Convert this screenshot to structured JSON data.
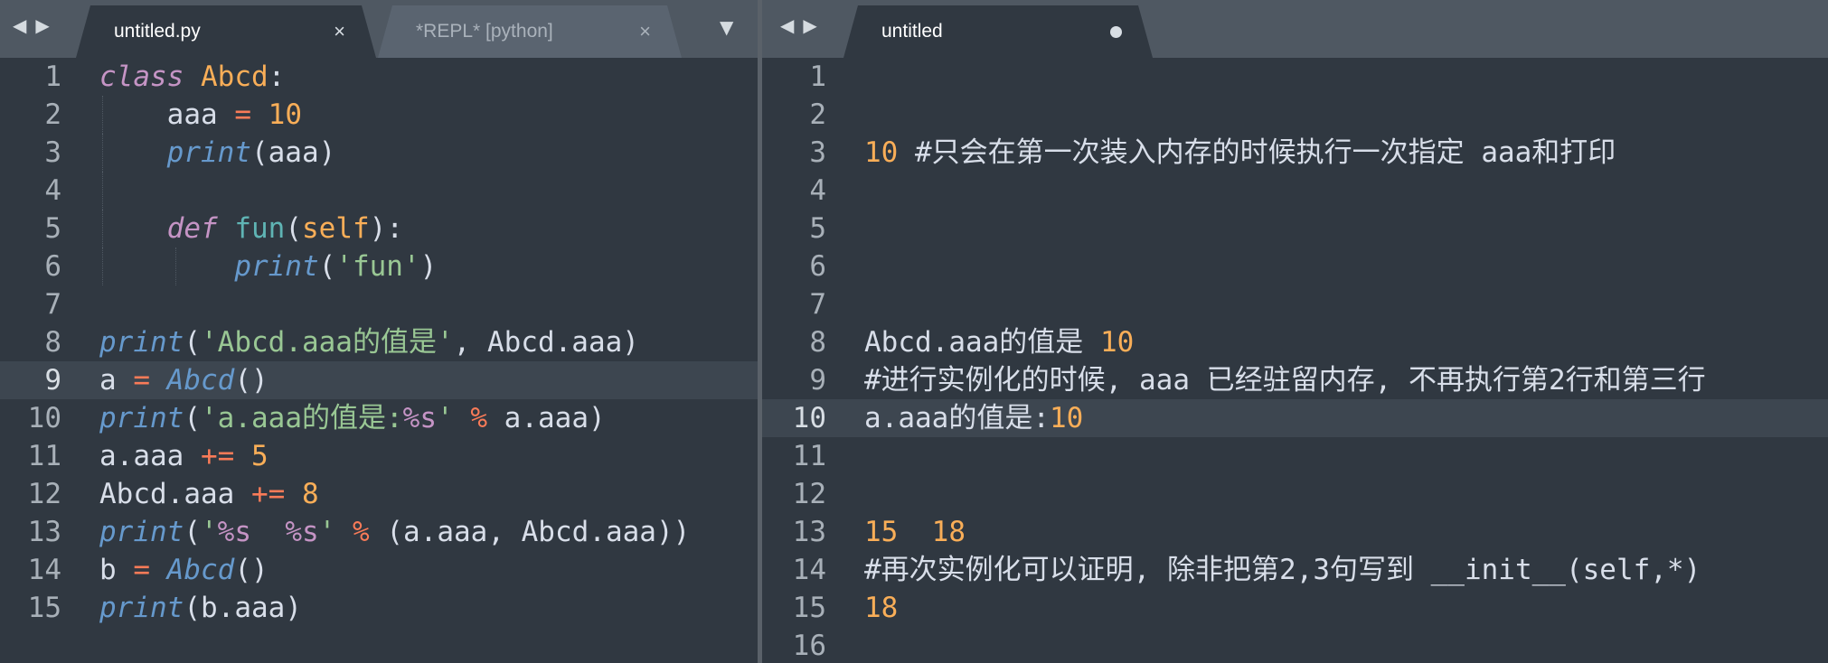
{
  "left_pane": {
    "nav_back": "◀",
    "nav_forward": "▶",
    "tabs": [
      {
        "label": "untitled.py",
        "close": "×"
      },
      {
        "label": "*REPL* [python]",
        "close": "×"
      }
    ],
    "dropdown": "▼",
    "current_line": 9,
    "lines": [
      {
        "num": "1",
        "segments": [
          {
            "t": "class",
            "c": "kw"
          },
          {
            "t": " "
          },
          {
            "t": "Abcd",
            "c": "cls"
          },
          {
            "t": ":"
          }
        ]
      },
      {
        "num": "2",
        "segments": [
          {
            "t": "    aaa "
          },
          {
            "t": "=",
            "c": "op"
          },
          {
            "t": " "
          },
          {
            "t": "10",
            "c": "num"
          }
        ]
      },
      {
        "num": "3",
        "segments": [
          {
            "t": "    "
          },
          {
            "t": "print",
            "c": "bi"
          },
          {
            "t": "(aaa)"
          }
        ]
      },
      {
        "num": "4",
        "segments": [
          {
            "t": ""
          }
        ]
      },
      {
        "num": "5",
        "segments": [
          {
            "t": "    "
          },
          {
            "t": "def",
            "c": "kw"
          },
          {
            "t": " "
          },
          {
            "t": "fun",
            "c": "fn"
          },
          {
            "t": "("
          },
          {
            "t": "self",
            "c": "self"
          },
          {
            "t": "):"
          }
        ]
      },
      {
        "num": "6",
        "segments": [
          {
            "t": "        "
          },
          {
            "t": "print",
            "c": "bi"
          },
          {
            "t": "("
          },
          {
            "t": "'fun'",
            "c": "str"
          },
          {
            "t": ")"
          }
        ]
      },
      {
        "num": "7",
        "segments": [
          {
            "t": ""
          }
        ]
      },
      {
        "num": "8",
        "segments": [
          {
            "t": "print",
            "c": "bi"
          },
          {
            "t": "("
          },
          {
            "t": "'Abcd.aaa的值是'",
            "c": "str"
          },
          {
            "t": ", Abcd.aaa)"
          }
        ]
      },
      {
        "num": "9",
        "segments": [
          {
            "t": "a "
          },
          {
            "t": "=",
            "c": "op"
          },
          {
            "t": " "
          },
          {
            "t": "Abcd",
            "c": "bi"
          },
          {
            "t": "()"
          }
        ]
      },
      {
        "num": "10",
        "segments": [
          {
            "t": "print",
            "c": "bi"
          },
          {
            "t": "("
          },
          {
            "t": "'a.aaa的值是:",
            "c": "str"
          },
          {
            "t": "%s",
            "c": "fmt"
          },
          {
            "t": "'",
            "c": "str"
          },
          {
            "t": " "
          },
          {
            "t": "%",
            "c": "op"
          },
          {
            "t": " a.aaa)"
          }
        ]
      },
      {
        "num": "11",
        "segments": [
          {
            "t": "a.aaa "
          },
          {
            "t": "+=",
            "c": "op"
          },
          {
            "t": " "
          },
          {
            "t": "5",
            "c": "num"
          }
        ]
      },
      {
        "num": "12",
        "segments": [
          {
            "t": "Abcd.aaa "
          },
          {
            "t": "+=",
            "c": "op"
          },
          {
            "t": " "
          },
          {
            "t": "8",
            "c": "num"
          }
        ]
      },
      {
        "num": "13",
        "segments": [
          {
            "t": "print",
            "c": "bi"
          },
          {
            "t": "("
          },
          {
            "t": "'",
            "c": "str"
          },
          {
            "t": "%s",
            "c": "fmt"
          },
          {
            "t": "  ",
            "c": "str"
          },
          {
            "t": "%s",
            "c": "fmt"
          },
          {
            "t": "'",
            "c": "str"
          },
          {
            "t": " "
          },
          {
            "t": "%",
            "c": "op"
          },
          {
            "t": " (a.aaa, Abcd.aaa))"
          }
        ]
      },
      {
        "num": "14",
        "segments": [
          {
            "t": "b "
          },
          {
            "t": "=",
            "c": "op"
          },
          {
            "t": " "
          },
          {
            "t": "Abcd",
            "c": "bi"
          },
          {
            "t": "()"
          }
        ]
      },
      {
        "num": "15",
        "segments": [
          {
            "t": "print",
            "c": "bi"
          },
          {
            "t": "(b.aaa)"
          }
        ]
      }
    ]
  },
  "right_pane": {
    "nav_back": "◀",
    "nav_forward": "▶",
    "tabs": [
      {
        "label": "untitled",
        "close": "●"
      }
    ],
    "current_line": 10,
    "lines": [
      {
        "num": "1",
        "segments": [
          {
            "t": ""
          }
        ]
      },
      {
        "num": "2",
        "segments": [
          {
            "t": ""
          }
        ]
      },
      {
        "num": "3",
        "segments": [
          {
            "t": "10",
            "c": "num"
          },
          {
            "t": " #只会在第一次装入内存的时候执行一次指定 aaa和打印"
          }
        ]
      },
      {
        "num": "4",
        "segments": [
          {
            "t": ""
          }
        ]
      },
      {
        "num": "5",
        "segments": [
          {
            "t": ""
          }
        ]
      },
      {
        "num": "6",
        "segments": [
          {
            "t": ""
          }
        ]
      },
      {
        "num": "7",
        "segments": [
          {
            "t": ""
          }
        ]
      },
      {
        "num": "8",
        "segments": [
          {
            "t": "Abcd.aaa的值是 "
          },
          {
            "t": "10",
            "c": "num"
          }
        ]
      },
      {
        "num": "9",
        "segments": [
          {
            "t": "#进行实例化的时候, aaa 已经驻留内存, 不再执行第2行和第三行"
          }
        ]
      },
      {
        "num": "10",
        "segments": [
          {
            "t": "a.aaa的值是:"
          },
          {
            "t": "10",
            "c": "num"
          }
        ]
      },
      {
        "num": "11",
        "segments": [
          {
            "t": ""
          }
        ]
      },
      {
        "num": "12",
        "segments": [
          {
            "t": ""
          }
        ]
      },
      {
        "num": "13",
        "segments": [
          {
            "t": "15",
            "c": "num"
          },
          {
            "t": "  "
          },
          {
            "t": "18",
            "c": "num"
          }
        ]
      },
      {
        "num": "14",
        "segments": [
          {
            "t": "#再次实例化可以证明, 除非把第2,3句写到 __init__(self,*)"
          }
        ]
      },
      {
        "num": "15",
        "segments": [
          {
            "t": "18",
            "c": "num"
          }
        ]
      },
      {
        "num": "16",
        "segments": [
          {
            "t": ""
          }
        ]
      }
    ]
  }
}
